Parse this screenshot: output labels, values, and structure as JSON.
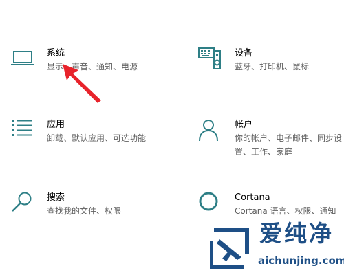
{
  "tiles": {
    "system": {
      "title": "系统",
      "desc": "显示、声音、通知、电源",
      "icon": "laptop-icon"
    },
    "devices": {
      "title": "设备",
      "desc": "蓝牙、打印机、鼠标",
      "icon": "keyboard-speaker-icon"
    },
    "apps": {
      "title": "应用",
      "desc": "卸载、默认应用、可选功能",
      "icon": "apps-list-icon"
    },
    "accounts": {
      "title": "帐户",
      "desc": "你的帐户、电子邮件、同步设置、工作、家庭",
      "icon": "person-icon"
    },
    "search": {
      "title": "搜索",
      "desc": "查找我的文件、权限",
      "icon": "search-icon"
    },
    "cortana": {
      "title": "Cortana",
      "desc": "Cortana 语言、权限、通知",
      "icon": "cortana-circle-icon"
    }
  },
  "watermark": {
    "brand": "爱纯净",
    "url": "aichunjing.com"
  },
  "colors": {
    "icon_accent": "#2e7f86",
    "arrow": "#e8232b",
    "watermark": "#1e4f86",
    "desc_text": "#5f5f5f"
  }
}
